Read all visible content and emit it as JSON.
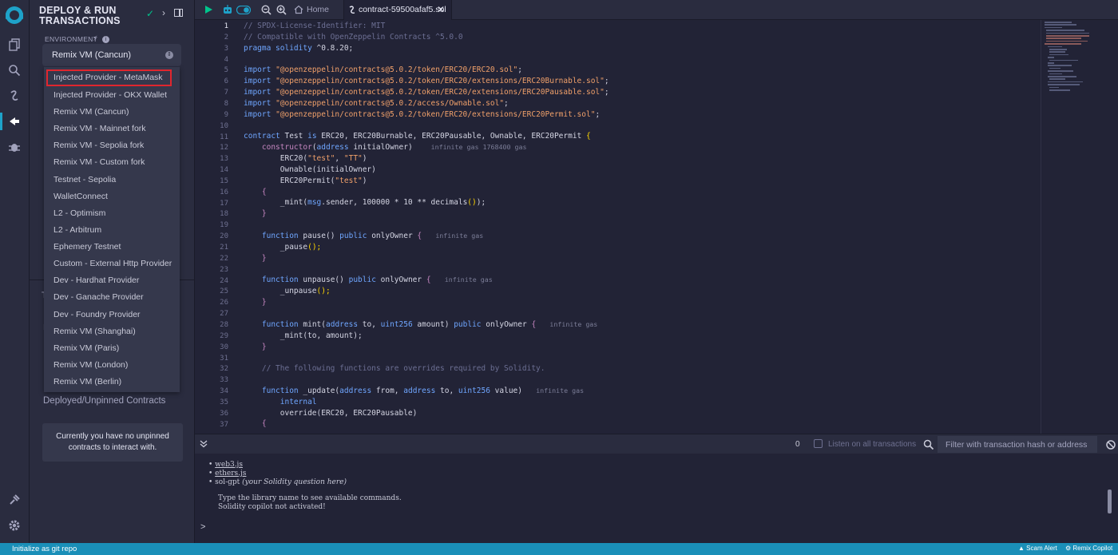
{
  "sidebar": {
    "title": "DEPLOY & RUN TRANSACTIONS",
    "environment_label": "ENVIRONMENT",
    "environment_selected": "Remix VM (Cancun)",
    "environment_options": [
      "Injected Provider - MetaMask",
      "Injected Provider - OKX Wallet",
      "Remix VM (Cancun)",
      "Remix VM - Mainnet fork",
      "Remix VM - Sepolia fork",
      "Remix VM - Custom fork",
      "Testnet - Sepolia",
      "WalletConnect",
      "L2 - Optimism",
      "L2 - Arbitrum",
      "Ephemery Testnet",
      "Custom - External Http Provider",
      "Dev - Hardhat Provider",
      "Dev - Ganache Provider",
      "Dev - Foundry Provider",
      "Remix VM (Shanghai)",
      "Remix VM (Paris)",
      "Remix VM (London)",
      "Remix VM (Berlin)"
    ],
    "highlighted_option": "Injected Provider - MetaMask",
    "fragment_1": "T",
    "fragment_2": "I",
    "fragment_3": ")",
    "deployed_label": "Deployed/Unpinned Contracts",
    "empty_notice": "Currently you have no unpinned contracts to interact with."
  },
  "tabs": {
    "home": "Home",
    "file": "contract-59500afaf5.sol"
  },
  "editor": {
    "line_numbers": [
      "1",
      "2",
      "3",
      "4",
      "5",
      "6",
      "7",
      "8",
      "9",
      "10",
      "11",
      "12",
      "13",
      "14",
      "15",
      "16",
      "17",
      "18",
      "19",
      "20",
      "21",
      "22",
      "23",
      "24",
      "25",
      "26",
      "27",
      "28",
      "29",
      "30",
      "31",
      "32",
      "33",
      "34",
      "35",
      "36",
      "37"
    ],
    "code": {
      "l1": "// SPDX-License-Identifier: MIT",
      "l2": "// Compatible with OpenZeppelin Contracts ^5.0.0",
      "l3_kw": "pragma solidity",
      "l3_rest": " ^0.8.20;",
      "import": "import",
      "imp5": "\"@openzeppelin/contracts@5.0.2/token/ERC20/ERC20.sol\"",
      "imp6": "\"@openzeppelin/contracts@5.0.2/token/ERC20/extensions/ERC20Burnable.sol\"",
      "imp7": "\"@openzeppelin/contracts@5.0.2/token/ERC20/extensions/ERC20Pausable.sol\"",
      "imp8": "\"@openzeppelin/contracts@5.0.2/access/Ownable.sol\"",
      "imp9": "\"@openzeppelin/contracts@5.0.2/token/ERC20/extensions/ERC20Permit.sol\"",
      "semi": ";",
      "l11_kw": "contract",
      "l11_name": " Test ",
      "l11_is": "is",
      "l11_rest": " ERC20, ERC20Burnable, ERC20Pausable, Ownable, ERC20Permit ",
      "brace_open": "{",
      "brace_close": "}",
      "l12_kw": "constructor",
      "l12_paren_open": "(",
      "l12_type": "address",
      "l12_rest": " initialOwner",
      "l12_paren_close": ")",
      "l12_gas": "infinite gas 1768400 gas",
      "l13_a": "ERC20(",
      "l13_s1": "\"test\"",
      "l13_comma": ", ",
      "l13_s2": "\"TT\"",
      "l13_b": ")",
      "l14": "Ownable(initialOwner)",
      "l15_a": "ERC20Permit(",
      "l15_s": "\"test\"",
      "l15_b": ")",
      "l17_a": "_mint(",
      "l17_msg": "msg",
      "l17_b": ".sender, 100000 * 10 ** decimals",
      "l17_c": "()",
      "l17_d": ");",
      "function": "function",
      "public": "public",
      "l20_a": " pause",
      "l20_b": "() ",
      "l20_c": " onlyOwner ",
      "gas_inf": "infinite gas",
      "l21": "_pause",
      "l21_p": "();",
      "l24_a": " unpause",
      "l25": "_unpause",
      "l28_a": " mint",
      "l28_b": "(",
      "address": "address",
      "l28_to": " to, ",
      "uint256": "uint256",
      "l28_amount": " amount",
      "l28_c": ") ",
      "l29": "_mint(to, amount);",
      "l32": "// The following functions are overrides required by Solidity.",
      "l34_a": " _update",
      "l34_b": "(",
      "l34_from": " from, ",
      "l34_value": " value",
      "l34_c": ")",
      "l35": "internal",
      "l36": "override(ERC20, ERC20Pausable)"
    }
  },
  "terminal": {
    "count": "0",
    "listen_label": "Listen on all transactions",
    "filter_placeholder": "Filter with transaction hash or address",
    "lines": {
      "web3": "web3.js",
      "ethers": "ethers.js",
      "solgpt_a": "sol-gpt ",
      "solgpt_b": "(your Solidity question here)",
      "hint": "Type the library name to see available commands.",
      "copilot": "Solidity copilot not activated!"
    },
    "prompt": ">"
  },
  "statusbar": {
    "left": "Initialize as git repo",
    "scam_alert": "Scam Alert",
    "copilot": "Remix Copilot"
  },
  "colors": {
    "accent": "#1ea2c9",
    "highlight_border": "#e0262e",
    "statusbar": "#1a8fb8"
  }
}
